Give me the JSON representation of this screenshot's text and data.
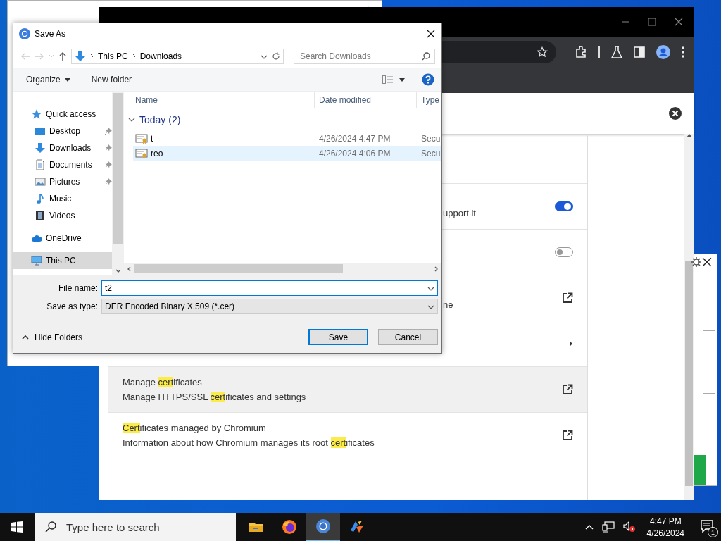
{
  "browser": {
    "settings_rows": [
      {
        "kind": "toggle",
        "on": true,
        "hovered": false,
        "description": [
          {
            "text": "upport it"
          }
        ]
      },
      {
        "kind": "toggle",
        "on": false,
        "hovered": false
      },
      {
        "kind": "external",
        "hovered": false,
        "description": [
          {
            "text": "ne"
          }
        ]
      },
      {
        "kind": "submenu",
        "hovered": false
      },
      {
        "kind": "external",
        "hovered": true,
        "title": [
          {
            "text": "Manage "
          },
          {
            "text": "cert",
            "highlight": true
          },
          {
            "text": "ificates"
          }
        ],
        "description": [
          {
            "text": "Manage HTTPS/SSL "
          },
          {
            "text": "cert",
            "highlight": true
          },
          {
            "text": "ificates and settings"
          }
        ]
      },
      {
        "kind": "external",
        "hovered": false,
        "title": [
          {
            "text": "Cert",
            "highlight": true
          },
          {
            "text": "ificates managed by Chromium"
          }
        ],
        "description": [
          {
            "text": "Information about how Chromium manages its root "
          },
          {
            "text": "cert",
            "highlight": true
          },
          {
            "text": "ificates"
          }
        ]
      }
    ]
  },
  "save_dialog": {
    "title": "Save As",
    "breadcrumb": [
      "This PC",
      "Downloads"
    ],
    "search_placeholder": "Search Downloads",
    "toolbar": [
      "Organize",
      "New folder"
    ],
    "nav_items": [
      {
        "kind": "star",
        "label": "Quick access",
        "selected": false,
        "children": [
          {
            "kind": "desktop",
            "label": "Desktop",
            "pinned": true,
            "selected": false
          },
          {
            "kind": "download",
            "label": "Downloads",
            "pinned": true,
            "selected": false
          },
          {
            "kind": "document",
            "label": "Documents",
            "pinned": true,
            "selected": false
          },
          {
            "kind": "pictures",
            "label": "Pictures",
            "pinned": true,
            "selected": false
          },
          {
            "kind": "music",
            "label": "Music",
            "pinned": false,
            "selected": false
          },
          {
            "kind": "videos",
            "label": "Videos",
            "pinned": false,
            "selected": false
          }
        ]
      },
      {
        "kind": "cloud",
        "label": "OneDrive",
        "selected": false
      },
      {
        "kind": "pc",
        "label": "This PC",
        "selected": true
      }
    ],
    "columns": [
      "Name",
      "Date modified",
      "Type"
    ],
    "groups": [
      {
        "label": "Today (2)",
        "expanded": true,
        "files": [
          {
            "name": "t",
            "date": "4/26/2024 4:47 PM",
            "type": "Secu",
            "selected": false
          },
          {
            "name": "reo",
            "date": "4/26/2024 4:06 PM",
            "type": "Secu",
            "selected": true
          }
        ]
      }
    ],
    "file_name_label": "File name:",
    "file_name": "t2",
    "type_label": "Save as type:",
    "type_value": "DER Encoded Binary X.509 (*.cer)",
    "hide_folders": "Hide Folders",
    "buttons": [
      {
        "label": "Save",
        "default": true
      },
      {
        "label": "Cancel",
        "default": false
      }
    ]
  },
  "taskbar": {
    "search_placeholder": "Type here to search",
    "apps": [
      {
        "kind": "folder",
        "active": false
      },
      {
        "kind": "firefox",
        "active": false
      },
      {
        "kind": "chromium",
        "active": true
      },
      {
        "kind": "app",
        "active": false
      }
    ],
    "time": "4:47 PM",
    "date": "4/26/2024",
    "notification_count": "1"
  }
}
